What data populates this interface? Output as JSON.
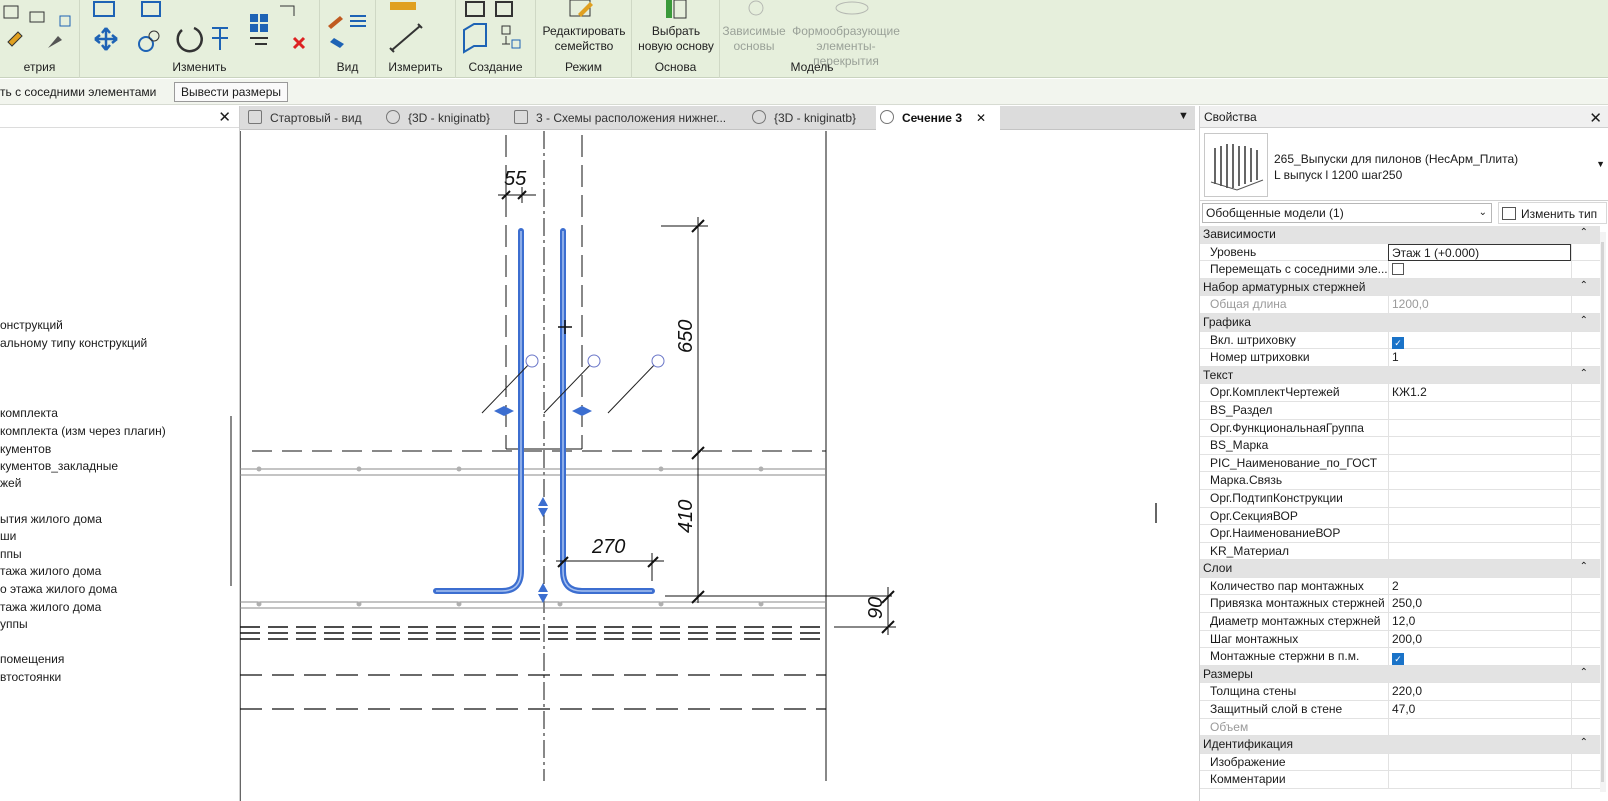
{
  "ribbon": {
    "groups": [
      "етрия",
      "Изменить",
      "Вид",
      "Измерить",
      "Создание",
      "Режим",
      "Основа",
      "Модель"
    ],
    "buttons": {
      "edit_family": "Редактировать\nсемейство",
      "pick_host": "Выбрать\nновую основу",
      "dependent_hosts": "Зависимые\nосновы",
      "forming_elements": "Формообразующие\nэлементы-перекрытия"
    }
  },
  "options_bar": {
    "text": "ть с соседними элементами",
    "button": "Вывести размеры"
  },
  "browser": {
    "close": "✕",
    "items": [
      "онструкций",
      "альному типу конструкций",
      "комплекта",
      "комплекта (изм через плагин)",
      "кументов",
      "кументов_закладные",
      "жей",
      "ытия жилого дома",
      "ши",
      "ппы",
      "тажа жилого дома",
      "о этажа жилого дома",
      "тажа жилого дома",
      "уппы",
      "",
      "помещения",
      "втостоянки"
    ]
  },
  "tabs": [
    {
      "label": "Стартовый - вид"
    },
    {
      "label": "{3D - kniginatb}"
    },
    {
      "label": "3 - Схемы расположения нижнег..."
    },
    {
      "label": "{3D - kniginatb}"
    },
    {
      "label": "Сечение 3",
      "close": "✕"
    }
  ],
  "tab_menu": "▼",
  "drawing": {
    "dims": [
      "55",
      "650",
      "410",
      "270",
      "90"
    ]
  },
  "properties": {
    "title": "Свойства",
    "close": "✕",
    "type_name_line1": "265_Выпуски для пилонов (НесАрм_Плита)",
    "type_name_line2": "L выпуск l 1200 шаг250",
    "filter": "Обобщенные модели (1)",
    "edit_type": "Изменить тип",
    "rows": [
      {
        "cat": true,
        "label": "Зависимости"
      },
      {
        "label": "Уровень",
        "value": "Этаж 1 (+0.000)"
      },
      {
        "label": "Перемещать с соседними эле...",
        "check": false
      },
      {
        "cat": true,
        "label": "Набор арматурных стержней"
      },
      {
        "label": "Общая длина",
        "value": "1200,0",
        "dim": true
      },
      {
        "cat": true,
        "label": "Графика"
      },
      {
        "label": "Вкл. штриховку",
        "check": true
      },
      {
        "label": "Номер штриховки",
        "value": "1"
      },
      {
        "cat": true,
        "label": "Текст"
      },
      {
        "label": "Орг.КомплектЧертежей",
        "value": "КЖ1.2"
      },
      {
        "label": "BS_Раздел",
        "value": ""
      },
      {
        "label": "Орг.ФункциональнаяГруппа",
        "value": ""
      },
      {
        "label": "BS_Марка",
        "value": ""
      },
      {
        "label": "PIC_Наименование_по_ГОСТ",
        "value": ""
      },
      {
        "label": "Марка.Связь",
        "value": ""
      },
      {
        "label": "Орг.ПодтипКонструкции",
        "value": ""
      },
      {
        "label": "Орг.СекцияВОР",
        "value": ""
      },
      {
        "label": "Орг.НаименованиеВОР",
        "value": ""
      },
      {
        "label": "KR_Материал",
        "value": ""
      },
      {
        "cat": true,
        "label": "Слои"
      },
      {
        "label": "Количество пар монтажных",
        "value": "2"
      },
      {
        "label": "Привязка монтажных стержней",
        "value": "250,0"
      },
      {
        "label": "Диаметр монтажных стержней",
        "value": "12,0"
      },
      {
        "label": "Шаг монтажных",
        "value": "200,0"
      },
      {
        "label": "Монтажные стержни в п.м.",
        "check": true
      },
      {
        "cat": true,
        "label": "Размеры"
      },
      {
        "label": "Толщина стены",
        "value": "220,0"
      },
      {
        "label": "Защитный слой в стене",
        "value": "47,0"
      },
      {
        "label": "Объем",
        "value": "",
        "dim": true
      },
      {
        "cat": true,
        "label": "Идентификация"
      },
      {
        "label": "Изображение",
        "value": ""
      },
      {
        "label": "Комментарии",
        "value": ""
      }
    ]
  }
}
